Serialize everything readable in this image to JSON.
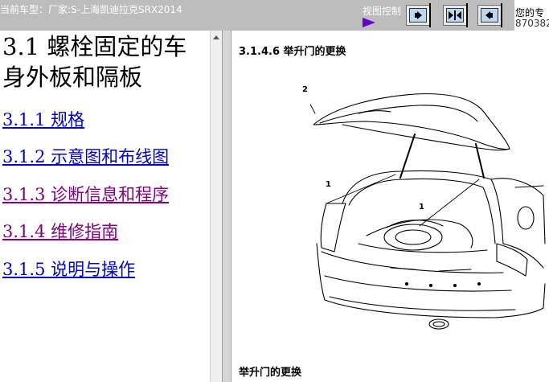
{
  "topbar": {
    "vehicle": "当前车型：厂家:S-上海凯迪拉克SRX2014",
    "view_control_label": "视图控制",
    "right_text_line1": "您的专",
    "right_text_line2": "870382",
    "buttons": [
      {
        "name": "expand-right-button",
        "icon": "arrow-right-icon"
      },
      {
        "name": "expand-both-button",
        "icon": "arrows-both-icon"
      },
      {
        "name": "expand-left-button",
        "icon": "arrow-left-icon"
      }
    ]
  },
  "nav": {
    "section_title": "3.1 螺栓固定的车身外板和隔板",
    "links": [
      {
        "label": "3.1.1 规格",
        "color": "#0000cc"
      },
      {
        "label": "3.1.2 示意图和布线图",
        "color": "#0000cc"
      },
      {
        "label": "3.1.3 诊断信息和程序",
        "color": "#800080"
      },
      {
        "label": "3.1.4 维修指南",
        "color": "#800080"
      },
      {
        "label": "3.1.5 说明与操作",
        "color": "#0000cc"
      }
    ]
  },
  "content": {
    "procedure_title": "3.1.4.6 举升门的更换",
    "callouts": [
      "2",
      "1",
      "1"
    ],
    "caption": "举升门的更换"
  }
}
